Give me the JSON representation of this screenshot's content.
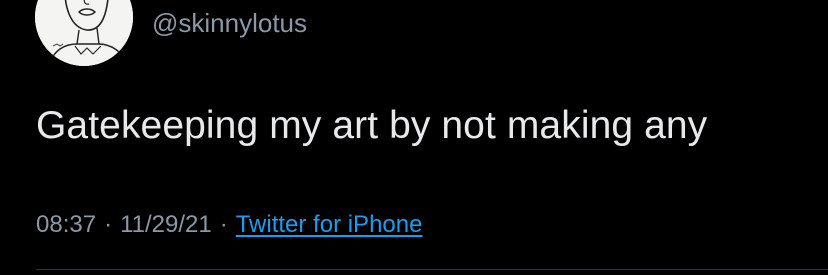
{
  "tweet": {
    "handle": "@skinnylotus",
    "text": "Gatekeeping my art by not making any",
    "time": "08:37",
    "date": "11/29/21",
    "separator": "·",
    "source": "Twitter for iPhone"
  },
  "colors": {
    "background": "#000000",
    "text": "#e7e9ea",
    "secondary": "#8b98a5",
    "link": "#1d9bf0"
  }
}
